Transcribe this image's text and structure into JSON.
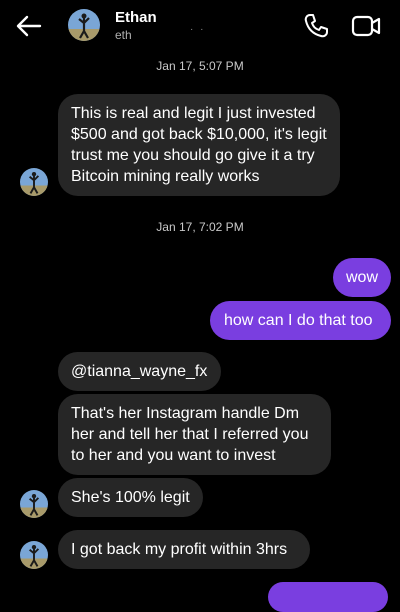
{
  "header": {
    "contact_name": "Ethan",
    "contact_username": "eth",
    "username_dots": "· ·",
    "icons": [
      "back-arrow-icon",
      "phone-icon",
      "video-camera-icon"
    ]
  },
  "thread": {
    "timestamp_1": "Jan 17, 5:07 PM",
    "msg_1": "This is real and legit I just invested $500 and got back $10,000, it's legit trust me you should go give it a try Bitcoin mining really works",
    "timestamp_2": "Jan 17, 7:02 PM",
    "msg_2": "wow",
    "msg_3": "how can I do that too",
    "msg_4": "@tianna_wayne_fx",
    "msg_5": "That's her Instagram handle Dm her and tell her that I referred you to her and you want to invest",
    "msg_6": "She's 100% legit",
    "msg_7": "I got back my profit within 3hrs"
  },
  "colors": {
    "background": "#000000",
    "incoming_bubble": "#262626",
    "outgoing_bubble": "#7a3ee0",
    "text": "#ffffff",
    "timestamp": "#c9c9c9"
  }
}
